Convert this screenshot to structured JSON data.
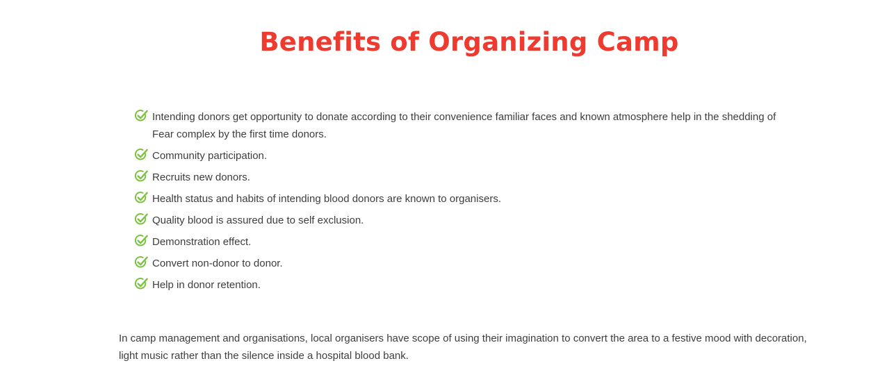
{
  "section": {
    "title": "Benefits of Organizing Camp"
  },
  "benefits": {
    "icon": "check-circle-icon",
    "icon_color": "#7cc242",
    "items": [
      "Intending donors get opportunity to donate according to their convenience familiar faces and known atmosphere help in the shedding of Fear complex by the first time donors.",
      "Community participation.",
      "Recruits new donors.",
      "Health status and habits of intending blood donors are known to organisers.",
      "Quality blood is assured due to self exclusion.",
      "Demonstration effect.",
      "Convert non-donor to donor.",
      "Help in donor retention."
    ]
  },
  "paragraph": {
    "text": "In camp management and organisations, local organisers have scope of using their imagination to convert the area to a festive mood with decoration, light music rather than the silence inside a hospital blood bank."
  },
  "colors": {
    "title": "#ee3a2f",
    "body_text": "#3d3d3d",
    "check": "#7cc242"
  }
}
